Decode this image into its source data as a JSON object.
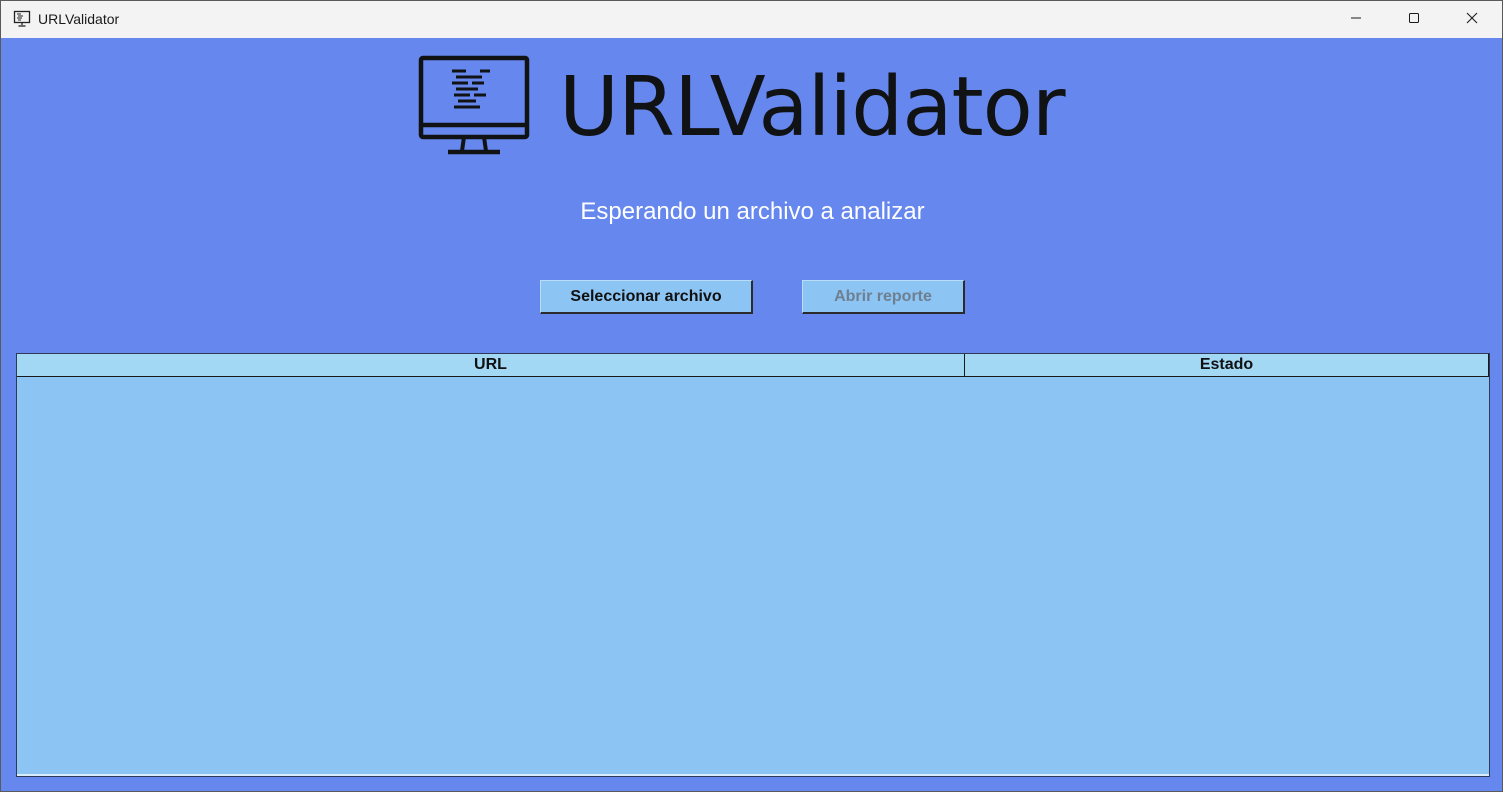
{
  "window": {
    "title": "URLValidator",
    "app_icon": "monitor-code-icon",
    "controls": {
      "minimize_icon": "minimize-icon",
      "maximize_icon": "maximize-icon",
      "close_icon": "close-icon"
    }
  },
  "header": {
    "logo_icon": "monitor-code-icon",
    "logo_text": "URLValidator",
    "status": "Esperando un archivo a analizar"
  },
  "actions": {
    "select_file_label": "Seleccionar archivo",
    "open_report_label": "Abrir reporte",
    "open_report_enabled": false
  },
  "table": {
    "columns": [
      "URL",
      "Estado"
    ],
    "rows": []
  },
  "colors": {
    "background": "#6587ee",
    "button": "#8cc5f3",
    "table_body": "#8cc5f3",
    "table_header": "#a2d8f4",
    "disabled_text": "#6f7f92"
  }
}
